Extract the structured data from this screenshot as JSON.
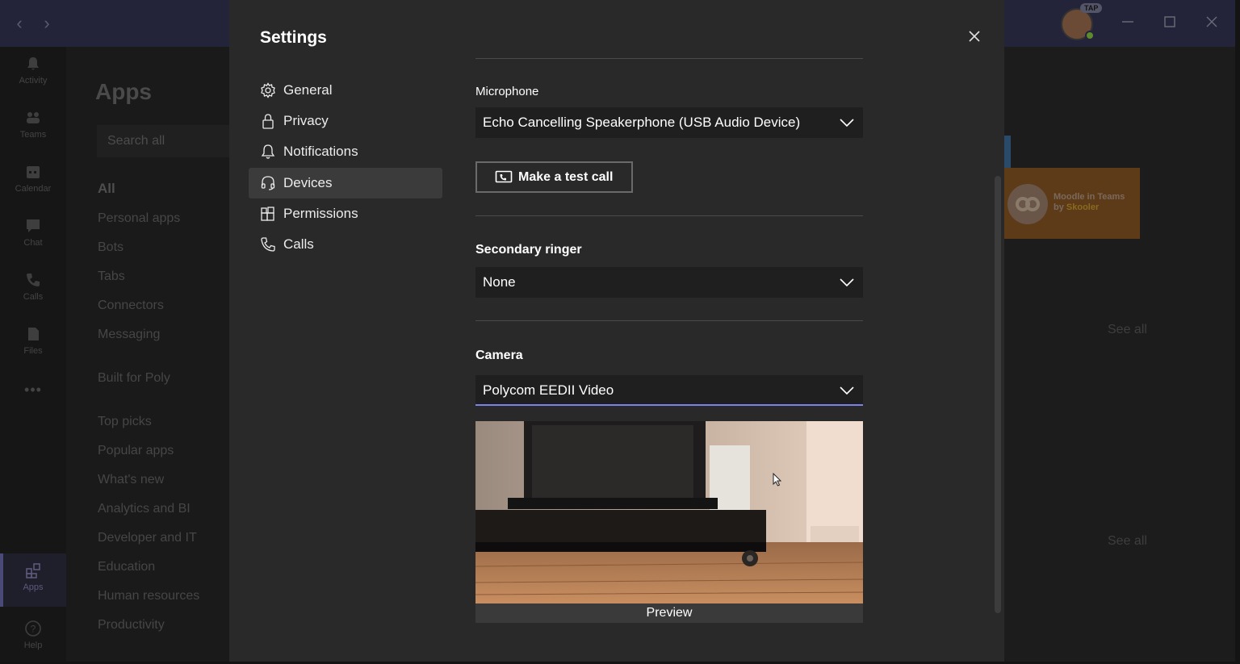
{
  "titlebar": {
    "back": "‹",
    "forward": "›",
    "avatar_badge": "TAP"
  },
  "rail": [
    {
      "label": "Activity",
      "icon": "bell-icon"
    },
    {
      "label": "Teams",
      "icon": "teams-icon"
    },
    {
      "label": "Calendar",
      "icon": "calendar-icon"
    },
    {
      "label": "Chat",
      "icon": "chat-icon"
    },
    {
      "label": "Calls",
      "icon": "phone-icon"
    },
    {
      "label": "Files",
      "icon": "file-icon"
    },
    {
      "label": "•••",
      "icon": "more-icon"
    },
    {
      "label": "Apps",
      "icon": "apps-icon"
    },
    {
      "label": "Help",
      "icon": "help-icon"
    }
  ],
  "apps": {
    "title": "Apps",
    "search_placeholder": "Search all",
    "categories": [
      "All",
      "Personal apps",
      "Bots",
      "Tabs",
      "Connectors",
      "Messaging",
      "Built for Poly",
      "Top picks",
      "Popular apps",
      "What's new",
      "Analytics and BI",
      "Developer and IT",
      "Education",
      "Human resources",
      "Productivity"
    ]
  },
  "background": {
    "moodle_line1": "Moodle in Teams",
    "moodle_by": "by",
    "moodle_author": "Skooler",
    "see_all": "See all"
  },
  "settings": {
    "title": "Settings",
    "nav": [
      {
        "label": "General",
        "icon": "gear-icon"
      },
      {
        "label": "Privacy",
        "icon": "lock-icon"
      },
      {
        "label": "Notifications",
        "icon": "bell-icon"
      },
      {
        "label": "Devices",
        "icon": "headset-icon"
      },
      {
        "label": "Permissions",
        "icon": "permissions-icon"
      },
      {
        "label": "Calls",
        "icon": "phone-icon"
      }
    ],
    "active_nav": "Devices",
    "microphone": {
      "label": "Microphone",
      "value": "Echo Cancelling Speakerphone (USB Audio Device)"
    },
    "test_call": {
      "label": "Make a test call"
    },
    "secondary_ringer": {
      "label": "Secondary ringer",
      "value": "None"
    },
    "camera": {
      "label": "Camera",
      "value": "Polycom EEDII Video"
    },
    "preview_label": "Preview"
  },
  "colors": {
    "accent": "#7b83eb",
    "dialog_bg": "#292929",
    "titlebar": "#23233a"
  }
}
